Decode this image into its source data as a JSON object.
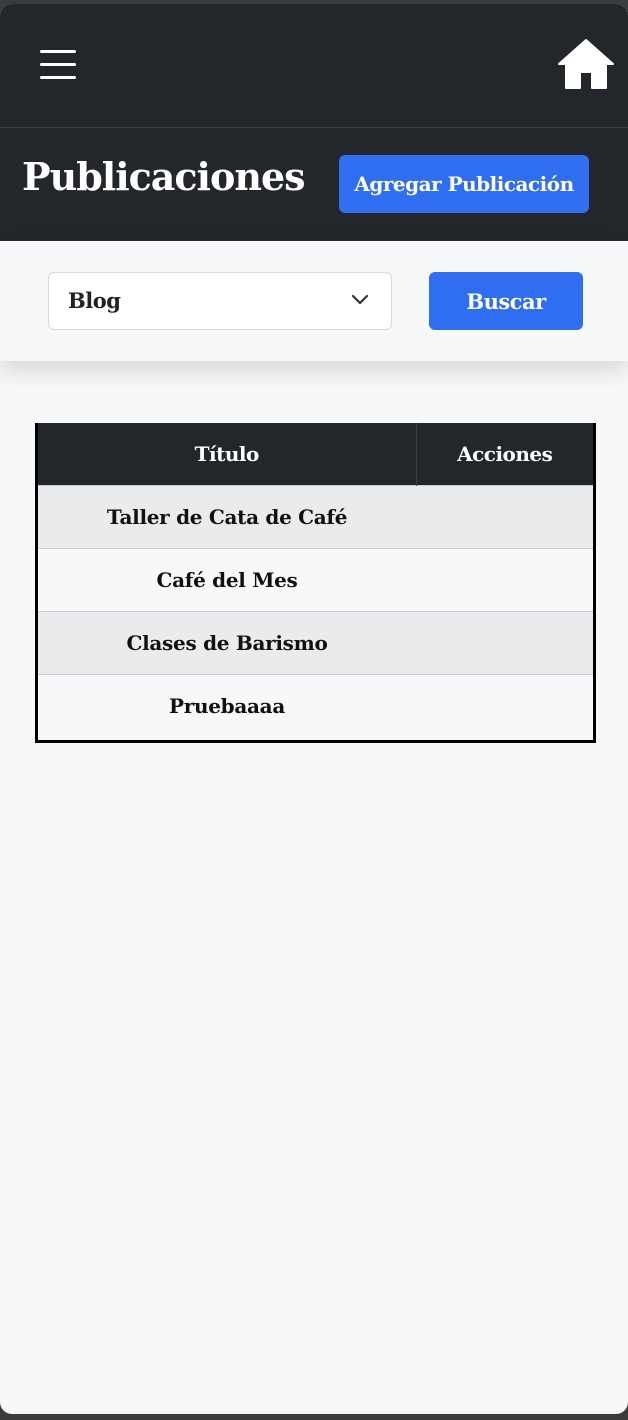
{
  "topbar": {
    "menu_icon": "hamburger-menu-icon",
    "home_icon": "home-icon"
  },
  "header": {
    "title": "Publicaciones",
    "add_button_label": "Agregar Publicación"
  },
  "filter": {
    "selected_category": "Blog",
    "dropdown_icon": "chevron-down-icon",
    "search_button_label": "Buscar"
  },
  "table": {
    "headers": {
      "title": "Título",
      "actions": "Acciones"
    },
    "rows": [
      {
        "title": "Taller de Cata de Café"
      },
      {
        "title": "Café del Mes"
      },
      {
        "title": "Clases de Barismo"
      },
      {
        "title": "Pruebaaaa"
      }
    ]
  },
  "colors": {
    "dark_bar": "#23262b",
    "accent_blue": "#2f6ef0",
    "page_background": "#f7f8fa"
  }
}
